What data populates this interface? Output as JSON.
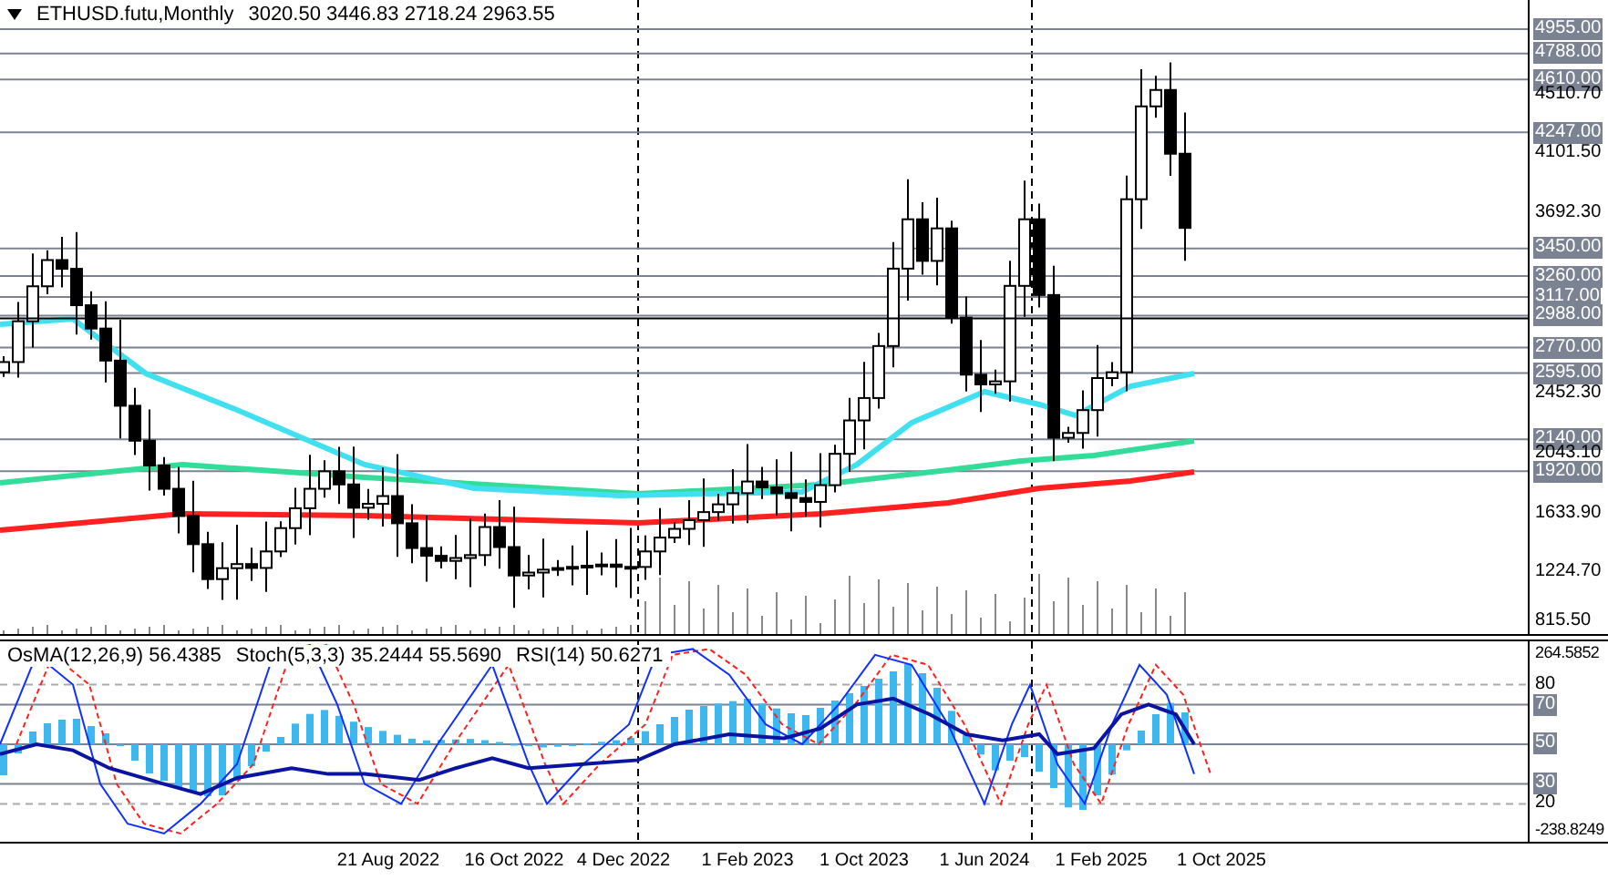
{
  "chart_header": {
    "symbol": "ETHUSD.futu,Monthly",
    "ohlc": "3020.50 3446.83 2718.24 2963.55"
  },
  "price_axis": [
    {
      "label": "4955.00",
      "kind": "level"
    },
    {
      "label": "4788.00",
      "kind": "level"
    },
    {
      "label": "4610.00",
      "kind": "level"
    },
    {
      "label": "4510.70",
      "kind": "tick"
    },
    {
      "label": "4247.00",
      "kind": "level"
    },
    {
      "label": "4101.50",
      "kind": "tick"
    },
    {
      "label": "3692.30",
      "kind": "tick"
    },
    {
      "label": "3450.00",
      "kind": "level"
    },
    {
      "label": "3260.00",
      "kind": "level"
    },
    {
      "label": "3117.00",
      "kind": "level"
    },
    {
      "label": "2988.00",
      "kind": "level"
    },
    {
      "label": "2770.00",
      "kind": "level"
    },
    {
      "label": "2595.00",
      "kind": "level"
    },
    {
      "label": "2452.30",
      "kind": "tick"
    },
    {
      "label": "2140.00",
      "kind": "level"
    },
    {
      "label": "2043.10",
      "kind": "tick"
    },
    {
      "label": "1920.00",
      "kind": "level"
    },
    {
      "label": "1633.90",
      "kind": "tick"
    },
    {
      "label": "1224.70",
      "kind": "tick"
    },
    {
      "label": "815.50",
      "kind": "tick"
    }
  ],
  "indicator_header": [
    "OsMA(12,26,9) 56.4385",
    "Stoch(5,3,3) 35.2444 55.5690",
    "RSI(14) 50.6271"
  ],
  "indicator_axis": [
    {
      "label": "264.5852",
      "kind": "tick"
    },
    {
      "label": "80",
      "kind": "dashed"
    },
    {
      "label": "70",
      "kind": "level"
    },
    {
      "label": "50",
      "kind": "level"
    },
    {
      "label": "30",
      "kind": "level"
    },
    {
      "label": "20",
      "kind": "dashed"
    },
    {
      "label": "-238.8249",
      "kind": "tick"
    }
  ],
  "time_axis": [
    "21 Aug 2022",
    "16 Oct 2022",
    "4 Dec 2022",
    "1 Feb 2023",
    "1 Oct 2023",
    "1 Jun 2024",
    "1 Feb 2025",
    "1 Oct 2025"
  ]
}
